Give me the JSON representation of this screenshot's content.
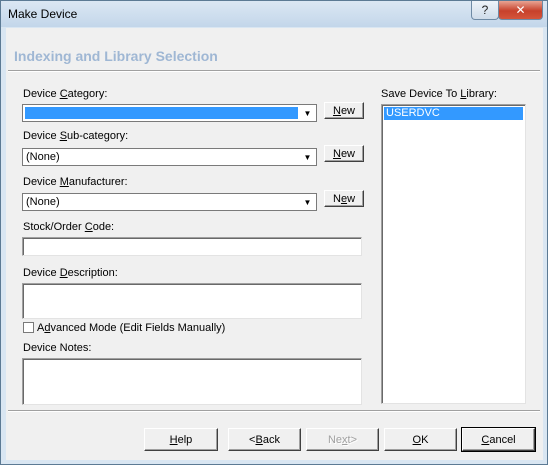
{
  "window": {
    "title": "Make Device",
    "help_glyph": "?",
    "close_glyph": "✕"
  },
  "section_title": "Indexing and Library Selection",
  "device_category": {
    "label_pre": "Device ",
    "label_u": "C",
    "label_post": "ategory:",
    "value": "",
    "new_label_u": "N",
    "new_label_post": "ew"
  },
  "device_subcategory": {
    "label_pre": "Device ",
    "label_u": "S",
    "label_post": "ub-category:",
    "value": "(None)",
    "new_label_u": "N",
    "new_label_post": "ew"
  },
  "device_manufacturer": {
    "label_pre": "Device ",
    "label_u": "M",
    "label_post": "anufacturer:",
    "value": "(None)",
    "new_label_pre": "N",
    "new_label_u": "e",
    "new_label_post": "w"
  },
  "stock_code": {
    "label_pre": "Stock/Order ",
    "label_u": "C",
    "label_post": "ode:",
    "value": ""
  },
  "description": {
    "label_pre": "Device ",
    "label_u": "D",
    "label_post": "escription:",
    "value": ""
  },
  "advanced_mode": {
    "label_pre": "A",
    "label_u": "d",
    "label_post": "vanced Mode (Edit Fields Manually)",
    "checked": false
  },
  "notes": {
    "label": "Device Notes:",
    "value": ""
  },
  "library": {
    "label_pre": "Save Device To ",
    "label_u": "L",
    "label_post": "ibrary:",
    "items": [
      "USERDVC"
    ]
  },
  "buttons": {
    "help_u": "H",
    "help_post": "elp",
    "back_pre": "<",
    "back_u": "B",
    "back_post": "ack",
    "next_pre": "Ne",
    "next_u": "x",
    "next_post": "t>",
    "ok_u": "O",
    "ok_post": "K",
    "cancel_pre": "",
    "cancel_u": "C",
    "cancel_post": "ancel"
  },
  "icons": {
    "dropdown": "chevron-down-icon"
  }
}
